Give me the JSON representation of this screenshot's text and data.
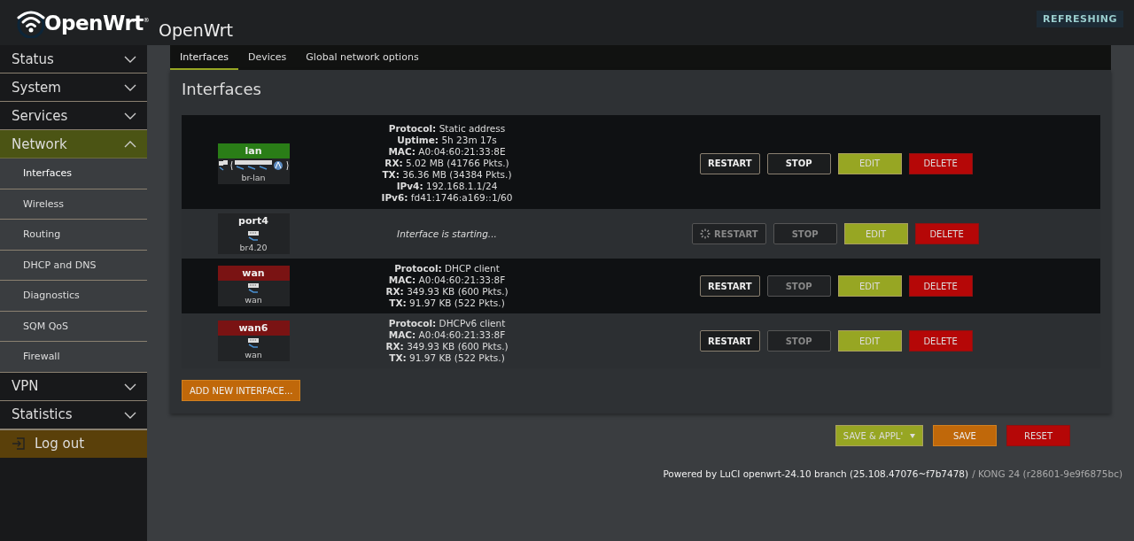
{
  "header": {
    "logo": "OpenWrt$^{®}$",
    "title": "OpenWrt",
    "status_badge": "REFRESHING"
  },
  "sidebar": {
    "items": [
      {
        "label": "Status",
        "expanded": false,
        "selected": false
      },
      {
        "label": "System",
        "expanded": false,
        "selected": false
      },
      {
        "label": "Services",
        "expanded": false,
        "selected": false
      },
      {
        "label": "Network",
        "expanded": true,
        "selected": true,
        "children": [
          {
            "label": "Interfaces",
            "selected": true
          },
          {
            "label": "Wireless",
            "selected": false
          },
          {
            "label": "Routing",
            "selected": false
          },
          {
            "label": "DHCP and DNS",
            "selected": false
          },
          {
            "label": "Diagnostics",
            "selected": false
          },
          {
            "label": "SQM QoS",
            "selected": false
          },
          {
            "label": "Firewall",
            "selected": false
          }
        ]
      },
      {
        "label": "VPN",
        "expanded": false,
        "selected": false
      },
      {
        "label": "Statistics",
        "expanded": false,
        "selected": false
      }
    ],
    "logout": "Log out"
  },
  "tabs": [
    {
      "label": "Interfaces",
      "selected": true
    },
    {
      "label": "Devices",
      "selected": false
    },
    {
      "label": "Global network options",
      "selected": false
    }
  ],
  "section_title": "Interfaces",
  "interfaces": [
    {
      "name": "lan",
      "color": "#2a7d17",
      "device": "br-lan",
      "bridge": true,
      "kind": "up",
      "info": [
        "**Protocol:** Static address",
        "**Uptime:** 5h 23m 17s",
        "**MAC:** A0:04:60:21:33:8E",
        "**RX:** 5.02 MB (41766 Pkts.)",
        "**TX:** 36.36 MB (34384 Pkts.)",
        "**IPv4:** 192.168.1.1/24",
        "**IPv6:** fd41:1746:a169::1/60"
      ],
      "buttons": {
        "restart": {
          "label": "RESTART",
          "disabled": false,
          "busy": false
        },
        "stop": {
          "label": "STOP",
          "disabled": false
        },
        "edit": "EDIT",
        "delete": "DELETE"
      }
    },
    {
      "name": "port4",
      "color": "#222426",
      "device": "br4.20",
      "bridge": false,
      "kind": "starting",
      "info": [
        "Interface is starting..."
      ],
      "buttons": {
        "restart": {
          "label": "RESTART",
          "disabled": true,
          "busy": true
        },
        "stop": {
          "label": "STOP",
          "disabled": true
        },
        "edit": "EDIT",
        "delete": "DELETE"
      }
    },
    {
      "name": "wan",
      "color": "#7a1313",
      "device": "wan",
      "bridge": false,
      "kind": "up",
      "info": [
        "**Protocol:** DHCP client",
        "**MAC:** A0:04:60:21:33:8F",
        "**RX:** 349.93 KB (600 Pkts.)",
        "**TX:** 91.97 KB (522 Pkts.)"
      ],
      "buttons": {
        "restart": {
          "label": "RESTART",
          "disabled": false,
          "busy": false
        },
        "stop": {
          "label": "STOP",
          "disabled": true
        },
        "edit": "EDIT",
        "delete": "DELETE"
      }
    },
    {
      "name": "wan6",
      "color": "#7a1313",
      "device": "wan",
      "bridge": false,
      "kind": "up",
      "info": [
        "**Protocol:** DHCPv6 client",
        "**MAC:** A0:04:60:21:33:8F",
        "**RX:** 349.93 KB (600 Pkts.)",
        "**TX:** 91.97 KB (522 Pkts.)"
      ],
      "buttons": {
        "restart": {
          "label": "RESTART",
          "disabled": false,
          "busy": false
        },
        "stop": {
          "label": "STOP",
          "disabled": true
        },
        "edit": "EDIT",
        "delete": "DELETE"
      }
    }
  ],
  "add_button": "ADD NEW INTERFACE...",
  "actions": {
    "save_apply": "SAVE & APPL'",
    "save": "SAVE",
    "reset": "RESET"
  },
  "footer": {
    "luci": "Powered by LuCI openwrt-24.10 branch (25.108.47076~f7b7478)",
    "build": "/ KONG 24 (r28601-9e9f6875bc)"
  }
}
